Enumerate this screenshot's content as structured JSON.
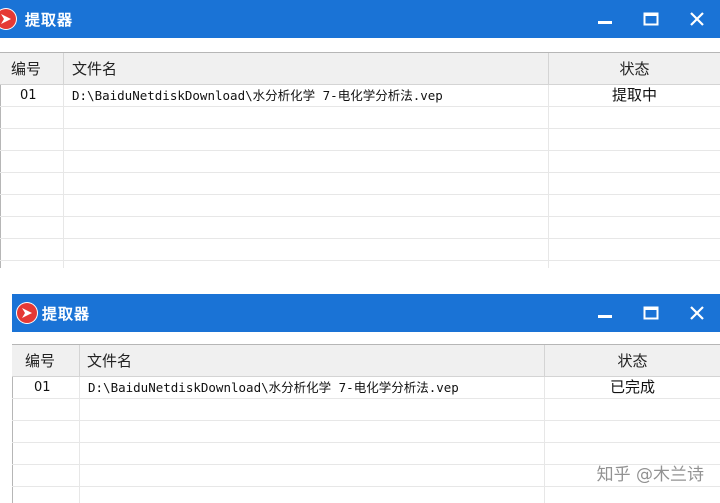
{
  "windows": [
    {
      "title": "提取器",
      "columns": {
        "id": "编号",
        "filename": "文件名",
        "status": "状态"
      },
      "rows": [
        {
          "id": "01",
          "filename": "D:\\BaiduNetdiskDownload\\水分析化学 7-电化学分析法.vep",
          "status": "提取中"
        }
      ],
      "empty_rows": 8
    },
    {
      "title": "提取器",
      "columns": {
        "id": "编号",
        "filename": "文件名",
        "status": "状态"
      },
      "rows": [
        {
          "id": "01",
          "filename": "D:\\BaiduNetdiskDownload\\水分析化学 7-电化学分析法.vep",
          "status": "已完成"
        }
      ],
      "empty_rows": 5
    }
  ],
  "titlebar_buttons": [
    "minimize-icon",
    "maximize-icon",
    "close-icon"
  ],
  "watermark": "知乎 @木兰诗",
  "colors": {
    "titlebar": "#1a73d6",
    "header_bg": "#f0f0f0",
    "grid_line": "#e7e7e7"
  }
}
